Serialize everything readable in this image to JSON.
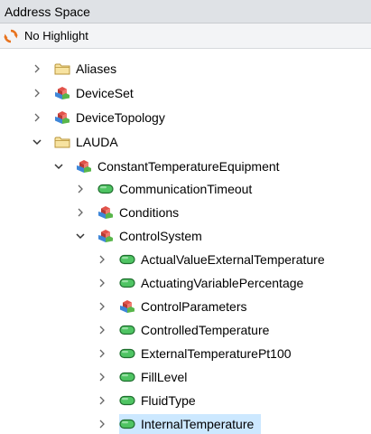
{
  "panel": {
    "title": "Address Space"
  },
  "toolbar": {
    "highlight_label": "No Highlight",
    "highlight_icon": "refresh-icon"
  },
  "colors": {
    "folder_fill": "#f7e3a1",
    "folder_stroke": "#b8953a",
    "variable_fill": "#4fc463",
    "variable_stroke": "#1f6e2e",
    "object_red": "#e2524a",
    "object_blue": "#3e86d8",
    "object_green": "#59b64b",
    "selection": "#cce8ff"
  },
  "tree": {
    "items": [
      {
        "label": "Aliases",
        "type": "folder",
        "expanded": false
      },
      {
        "label": "DeviceSet",
        "type": "object",
        "expanded": false
      },
      {
        "label": "DeviceTopology",
        "type": "object",
        "expanded": false
      },
      {
        "label": "LAUDA",
        "type": "folder",
        "expanded": true
      },
      {
        "label": "ConstantTemperatureEquipment",
        "type": "object",
        "expanded": true
      },
      {
        "label": "CommunicationTimeout",
        "type": "variable",
        "expanded": false
      },
      {
        "label": "Conditions",
        "type": "object",
        "expanded": false
      },
      {
        "label": "ControlSystem",
        "type": "object",
        "expanded": true
      },
      {
        "label": "ActualValueExternalTemperature",
        "type": "variable",
        "expanded": false
      },
      {
        "label": "ActuatingVariablePercentage",
        "type": "variable",
        "expanded": false
      },
      {
        "label": "ControlParameters",
        "type": "object",
        "expanded": false
      },
      {
        "label": "ControlledTemperature",
        "type": "variable",
        "expanded": false
      },
      {
        "label": "ExternalTemperaturePt100",
        "type": "variable",
        "expanded": false
      },
      {
        "label": "FillLevel",
        "type": "variable",
        "expanded": false
      },
      {
        "label": "FluidType",
        "type": "variable",
        "expanded": false
      },
      {
        "label": "InternalTemperature",
        "type": "variable",
        "expanded": false,
        "selected": true
      }
    ]
  }
}
